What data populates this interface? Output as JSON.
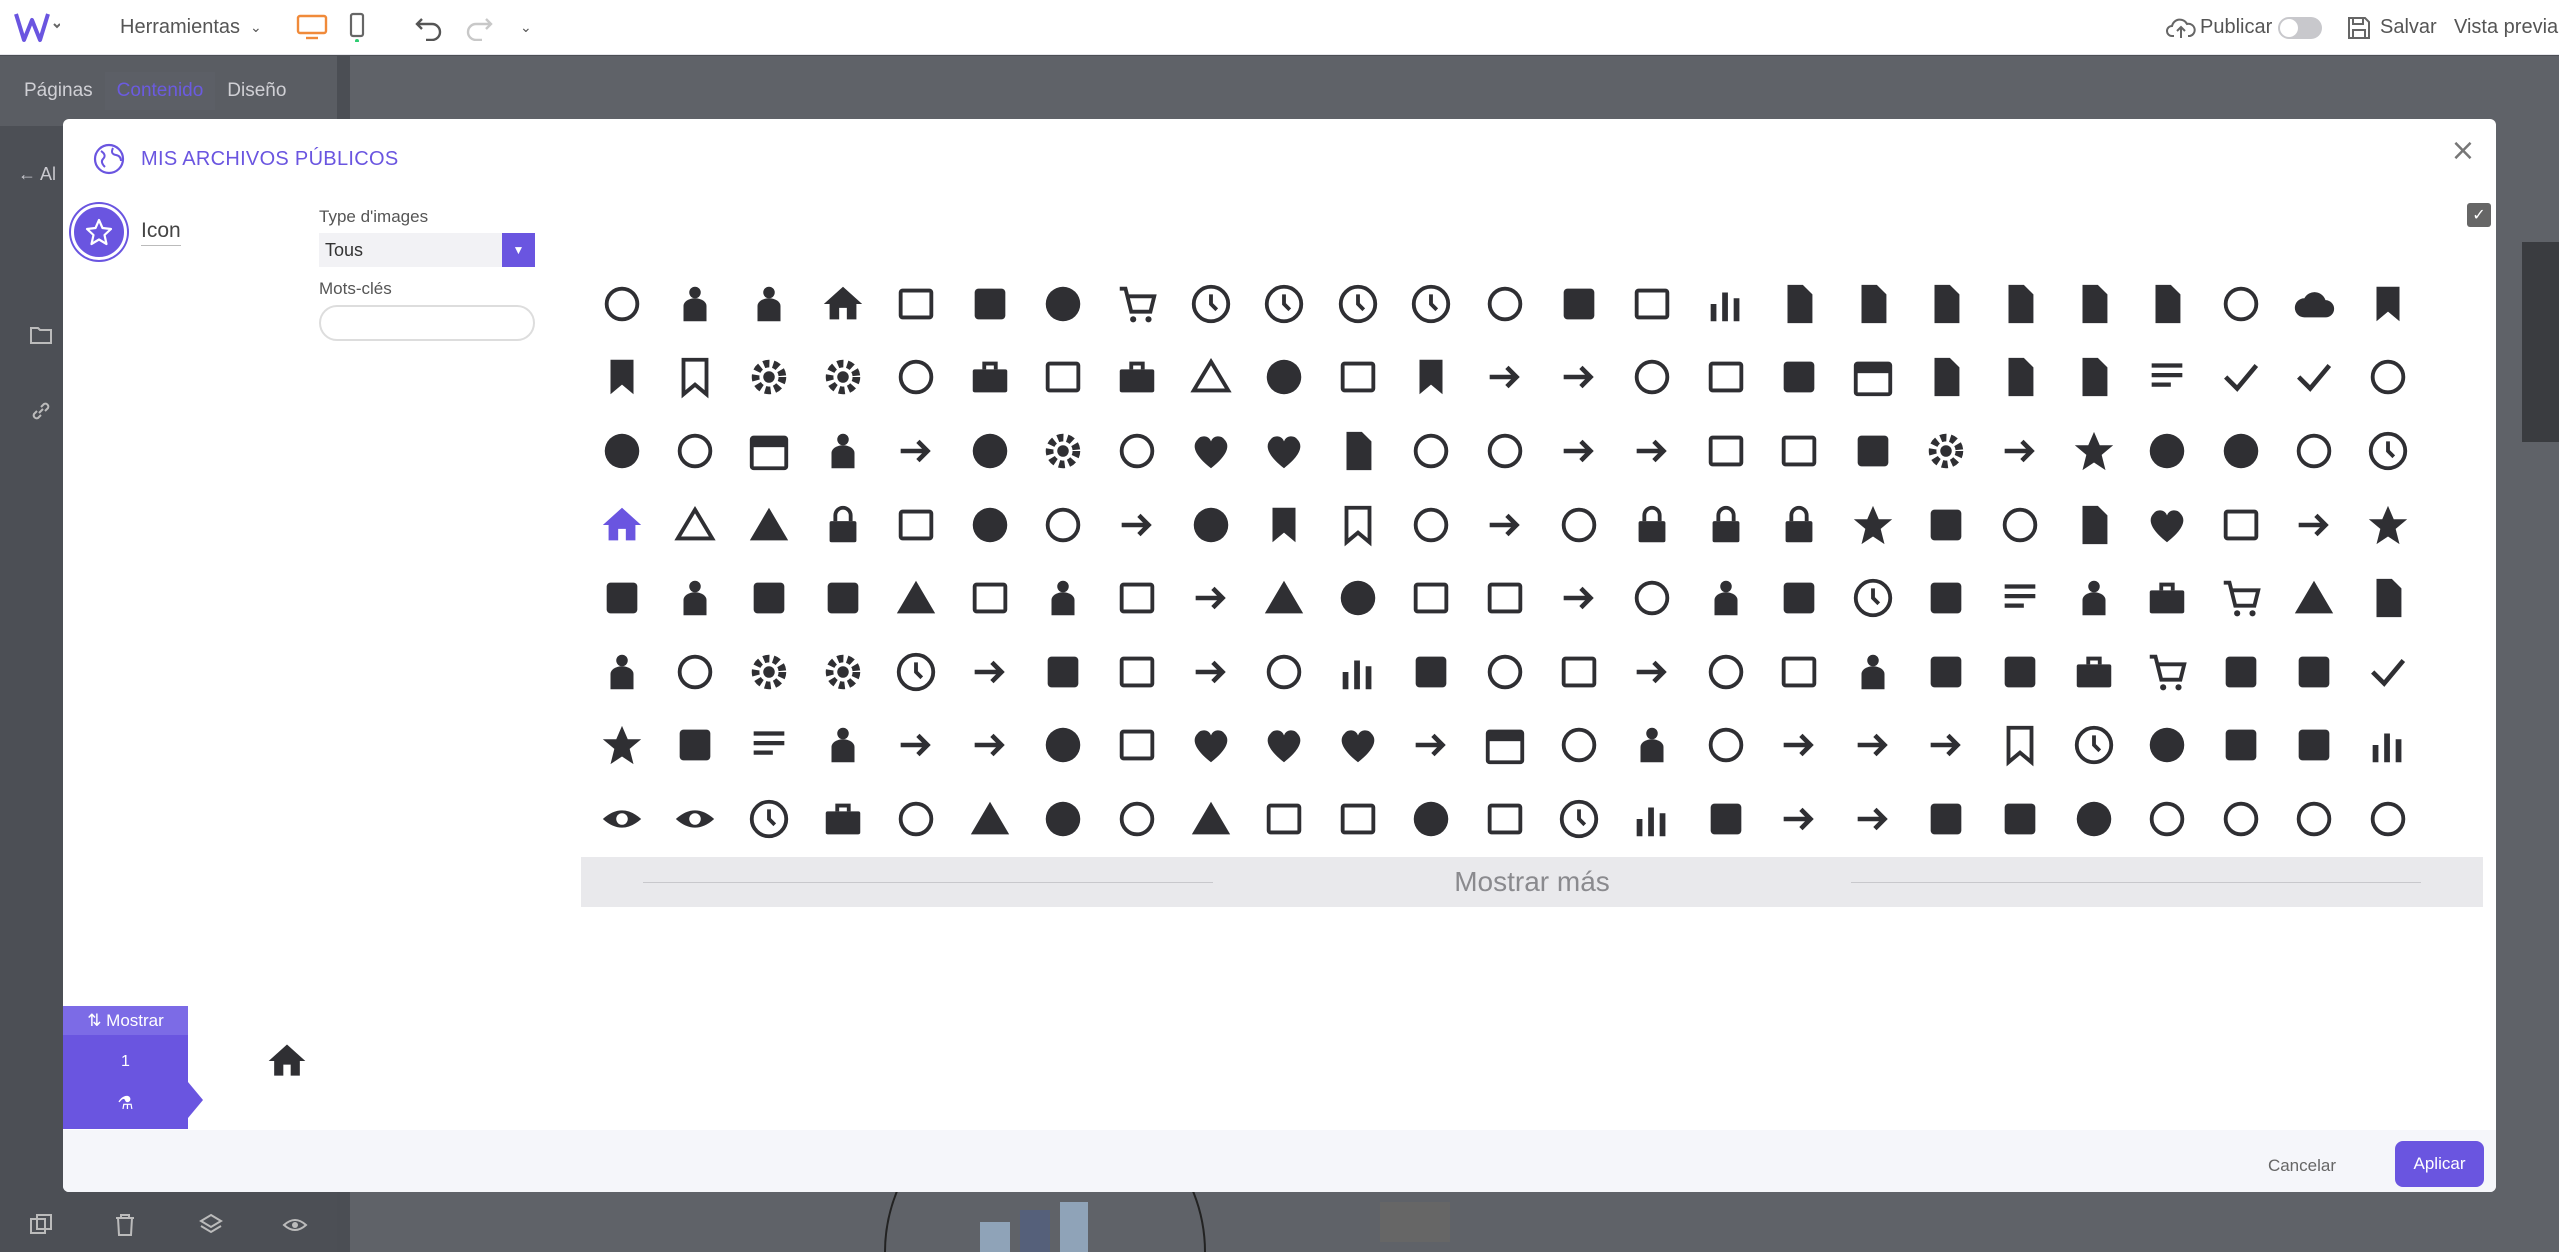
{
  "topbar": {
    "tools_label": "Herramientas",
    "publish_label": "Publicar",
    "save_label": "Salvar",
    "preview_label": "Vista previa"
  },
  "left_panel": {
    "tabs": [
      {
        "label": "Páginas"
      },
      {
        "label": "Contenido",
        "active": true
      },
      {
        "label": "Diseño"
      }
    ],
    "back_label": "Al"
  },
  "modal": {
    "title": "MIS ARCHIVOS PÚBLICOS",
    "category_label": "Icon",
    "type_label": "Type d'images",
    "type_value": "Tous",
    "keywords_label": "Mots-clés",
    "keywords_value": "",
    "show_more_label": "Mostrar más",
    "show_label": "⇅ Mostrar",
    "show_count": "1",
    "cancel_label": "Cancelar",
    "apply_label": "Aplicar",
    "icons": [
      "3d-rotation-icon",
      "accessibility-icon",
      "accessible-icon",
      "account-balance-icon",
      "account-balance-wallet-icon",
      "account-box-icon",
      "account-circle-icon",
      "add-shopping-cart-icon",
      "alarm-icon",
      "alarm-add-icon",
      "alarm-off-icon",
      "alarm-on-icon",
      "all-out-icon",
      "announcement-icon",
      "aspect-ratio-icon",
      "assessment-icon",
      "assignment-icon",
      "assignment-ind-icon",
      "assignment-late-icon",
      "assignment-return-icon",
      "assignment-returned-icon",
      "assignment-turned-in-icon",
      "autorenew-icon",
      "backup-icon",
      "book-icon",
      "bookmark-icon",
      "bookmark-border-icon",
      "bug-report-icon",
      "build-icon",
      "cached-icon",
      "redeem-icon",
      "card-membership-icon",
      "card-travel-icon",
      "change-history-icon",
      "check-circle-icon",
      "chrome-reader-mode-icon",
      "class-icon",
      "code-icon",
      "compare-arrows-icon",
      "copyright-icon",
      "credit-card-icon",
      "dashboard-icon",
      "date-range-icon",
      "delete-icon",
      "delete-forever-icon",
      "description-icon",
      "dns-icon",
      "done-icon",
      "done-all-icon",
      "donut-large-icon",
      "donut-small-icon",
      "euro-symbol-icon",
      "event-icon",
      "event-seat-icon",
      "exit-to-app-icon",
      "explore-icon",
      "extension-icon",
      "face-icon",
      "favorite-icon",
      "favorite-border-icon",
      "find-in-page-icon",
      "find-replace-icon",
      "fingerprint-icon",
      "flight-land-icon",
      "flight-takeoff-icon",
      "flip-to-back-icon",
      "flip-to-front-icon",
      "g-translate-icon",
      "gavel-icon",
      "get-app-icon",
      "star-icon",
      "group-work-icon",
      "help-icon",
      "highlight-off-icon",
      "history-icon",
      "home-icon",
      "hourglass-empty-icon",
      "hourglass-full-icon",
      "https-icon",
      "important-devices-icon",
      "info-icon",
      "info-outline-icon",
      "input-icon",
      "invert-colors-icon",
      "label-icon",
      "label-outline-icon",
      "language-icon",
      "launch-icon",
      "lightbulb-outline-icon",
      "lock-icon",
      "lock-open-icon",
      "lock-outline-icon",
      "loyalty-icon",
      "markunread-mailbox-icon",
      "motorcycle-icon",
      "note-add-icon",
      "opacity-icon",
      "open-in-browser-icon",
      "open-in-new-icon",
      "open-with-icon",
      "pageview-icon",
      "pan-tool-icon",
      "perm-camera-mic-icon",
      "perm-contact-calendar-icon",
      "perm-data-setting-icon",
      "perm-device-information-icon",
      "perm-identity-icon",
      "perm-media-icon",
      "perm-phone-msg-icon",
      "perm-scan-wifi-icon",
      "pets-icon",
      "picture-in-picture-icon",
      "picture-in-picture-alt-icon",
      "play-for-work-icon",
      "power-settings-icon",
      "pregnant-woman-icon",
      "print-icon",
      "query-builder-icon",
      "question-answer-icon",
      "receipt-icon",
      "record-voice-over-icon",
      "redeem-alt-icon",
      "remove-shopping-cart-icon",
      "report-problem-icon",
      "restore-page-icon",
      "rowing-icon",
      "search-icon",
      "settings-icon",
      "settings-applications-icon",
      "settings-backup-restore-icon",
      "settings-bluetooth-icon",
      "settings-brightness-icon",
      "settings-cell-icon",
      "settings-ethernet-icon",
      "settings-input-antenna-icon",
      "settings-input-component-icon",
      "settings-input-hdmi-icon",
      "settings-input-svideo-icon",
      "settings-overscan-icon",
      "settings-phone-icon",
      "settings-power-icon",
      "settings-remote-icon",
      "settings-voice-icon",
      "shop-icon",
      "shop-two-icon",
      "shopping-basket-icon",
      "shopping-cart-icon",
      "speaker-notes-icon",
      "speaker-notes-off-icon",
      "spellcheck-icon",
      "stars-icon",
      "store-icon",
      "subject-icon",
      "supervisor-account-icon",
      "swap-horiz-icon",
      "swap-vert-icon",
      "swap-vertical-circle-icon",
      "system-update-alt-icon",
      "thumb-down-icon",
      "thumb-up-icon",
      "thumbs-up-down-icon",
      "timeline-icon",
      "today-icon",
      "toll-icon",
      "touch-app-icon",
      "track-changes-icon",
      "trending-down-icon",
      "trending-flat-icon",
      "trending-up-icon",
      "turned-in-not-icon",
      "update-icon",
      "verified-user-icon",
      "view-array-icon",
      "view-module-icon",
      "view-column-icon",
      "visibility-icon",
      "visibility-off-icon",
      "watch-later-icon",
      "work-icon",
      "youtube-searched-for-icon",
      "add-alert-icon",
      "error-icon",
      "error-outline-icon",
      "warning-icon",
      "add-to-queue-icon",
      "airplay-icon",
      "album-icon",
      "art-track-icon",
      "av-timer-icon",
      "equalizer-icon",
      "explicit-icon",
      "fast-forward-icon",
      "fast-rewind-icon",
      "fiber-new-icon",
      "fiber-pin-icon",
      "fiber-manual-record-icon",
      "forward-10-icon",
      "forward-30-icon",
      "forward-5-icon",
      "hearing-icon"
    ]
  },
  "colors": {
    "accent": "#6a55e0",
    "icon": "#2f2f33",
    "overlay": "#4b4e54"
  }
}
